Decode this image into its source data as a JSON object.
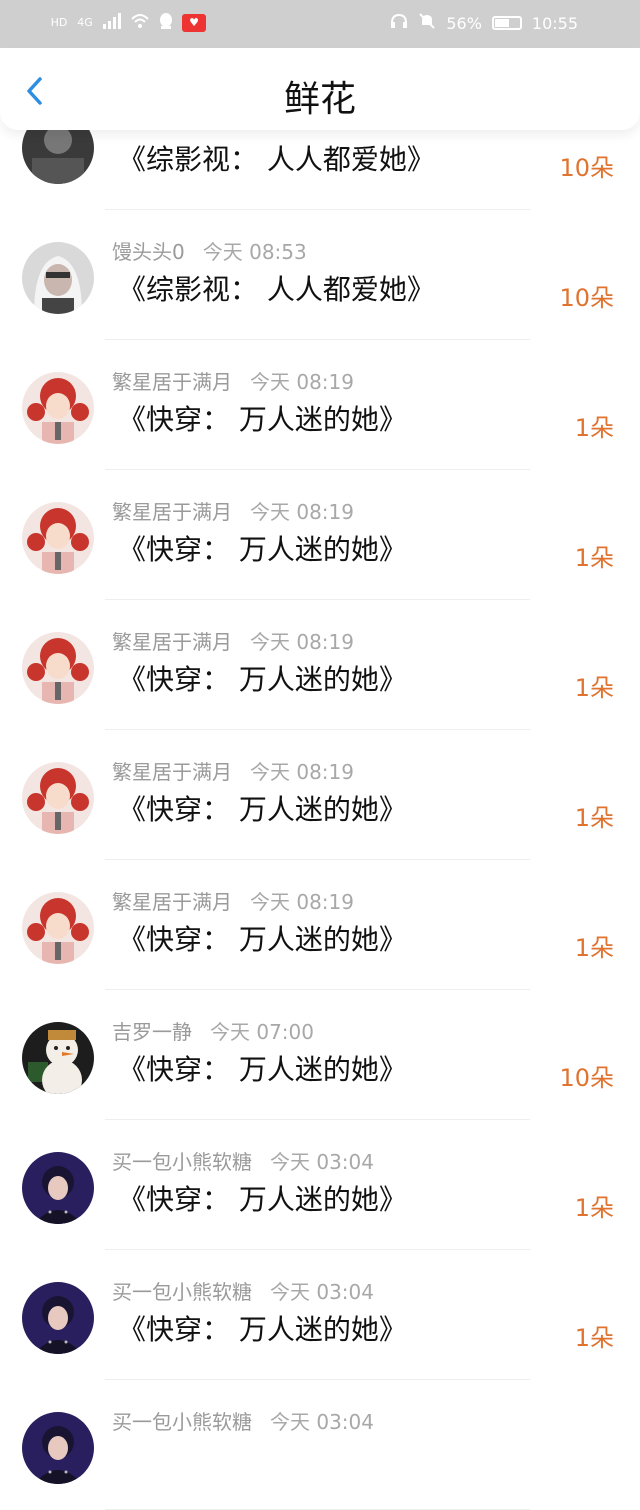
{
  "status_bar": {
    "left": [
      "HD",
      "4G"
    ],
    "battery": "56%",
    "time": "10:55",
    "icons": [
      "signal-icon",
      "wifi-icon",
      "qq-icon",
      "app-icon",
      "headphones-icon",
      "mute-icon",
      "battery-icon"
    ]
  },
  "header": {
    "title": "鲜花",
    "back_icon": "chevron-left-icon"
  },
  "rows": [
    {
      "name": "",
      "time": "",
      "book": "《综影视： 人人都爱她》",
      "count": "10朵",
      "avatar": "dark"
    },
    {
      "name": "馒头头0",
      "time": "今天 08:53",
      "book": "《综影视： 人人都爱她》",
      "count": "10朵",
      "avatar": "hood"
    },
    {
      "name": "繁星居于满月",
      "time": "今天 08:19",
      "book": "《快穿： 万人迷的她》",
      "count": "1朵",
      "avatar": "redhair"
    },
    {
      "name": "繁星居于满月",
      "time": "今天 08:19",
      "book": "《快穿： 万人迷的她》",
      "count": "1朵",
      "avatar": "redhair"
    },
    {
      "name": "繁星居于满月",
      "time": "今天 08:19",
      "book": "《快穿： 万人迷的她》",
      "count": "1朵",
      "avatar": "redhair"
    },
    {
      "name": "繁星居于满月",
      "time": "今天 08:19",
      "book": "《快穿： 万人迷的她》",
      "count": "1朵",
      "avatar": "redhair"
    },
    {
      "name": "繁星居于满月",
      "time": "今天 08:19",
      "book": "《快穿： 万人迷的她》",
      "count": "1朵",
      "avatar": "redhair"
    },
    {
      "name": "吉罗一静",
      "time": "今天 07:00",
      "book": "《快穿： 万人迷的她》",
      "count": "10朵",
      "avatar": "snowman"
    },
    {
      "name": "买一包小熊软糖",
      "time": "今天 03:04",
      "book": "《快穿： 万人迷的她》",
      "count": "1朵",
      "avatar": "idol"
    },
    {
      "name": "买一包小熊软糖",
      "time": "今天 03:04",
      "book": "《快穿： 万人迷的她》",
      "count": "1朵",
      "avatar": "idol"
    },
    {
      "name": "买一包小熊软糖",
      "time": "今天 03:04",
      "book": "",
      "count": "",
      "avatar": "idol"
    }
  ],
  "colors": {
    "accent": "#e0732f",
    "back": "#2f8ee0",
    "status_bg": "#cfcfcf"
  }
}
